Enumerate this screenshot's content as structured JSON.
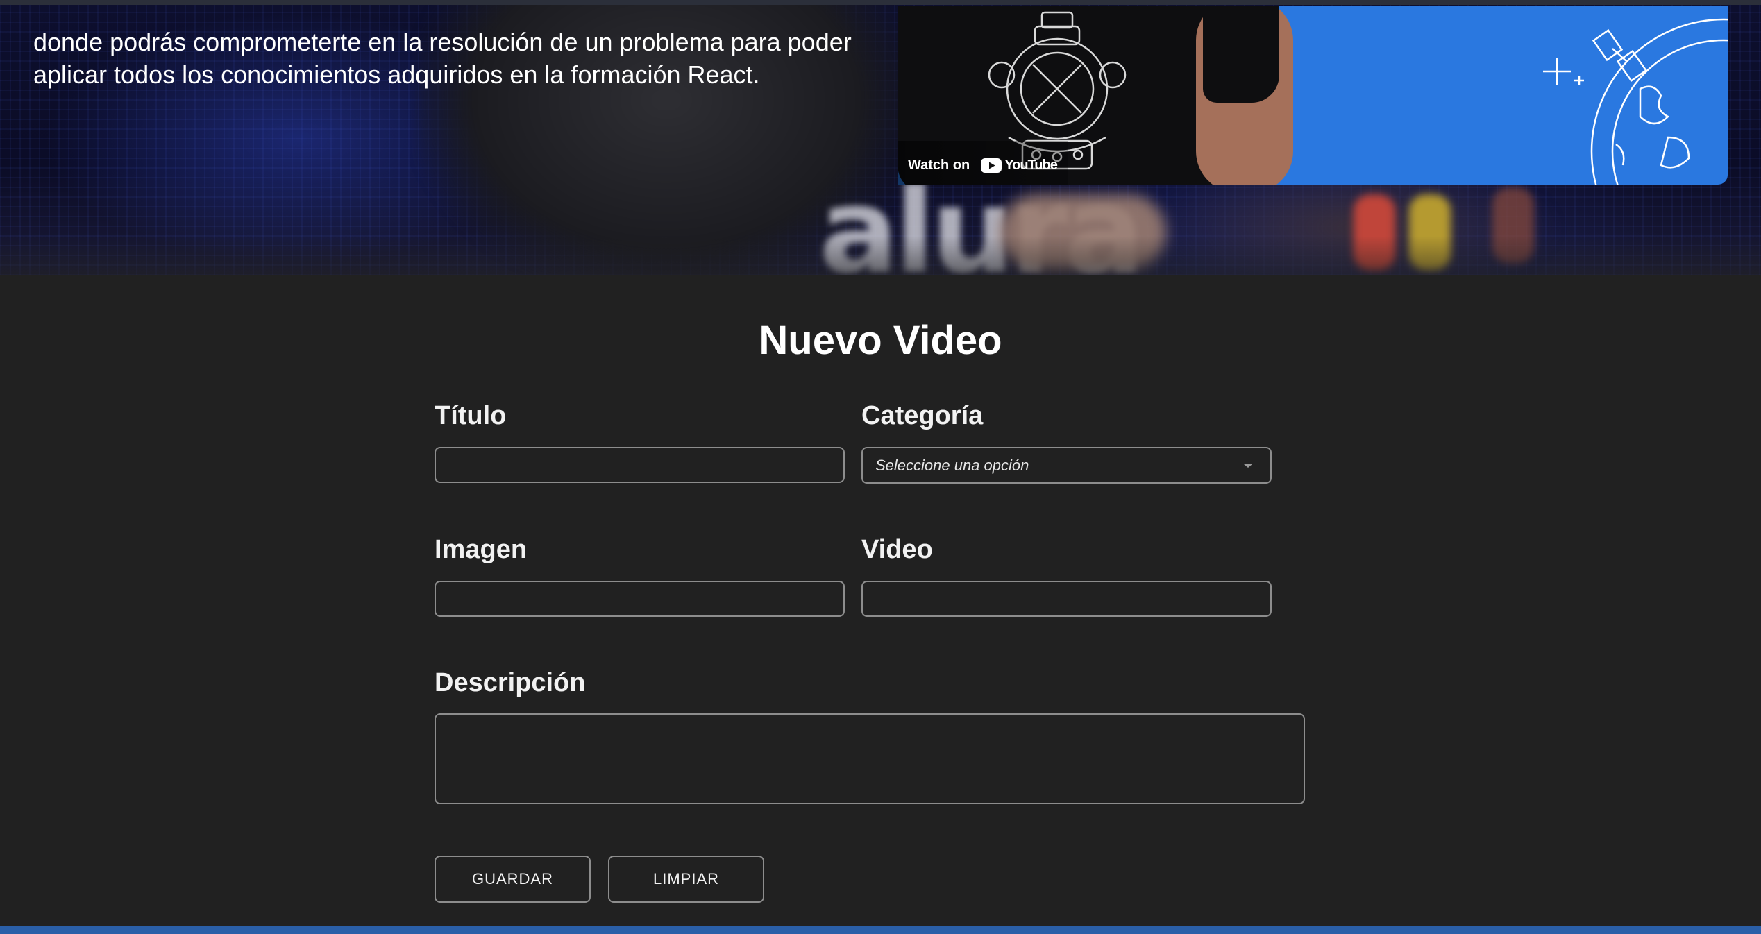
{
  "hero": {
    "description": "donde podrás comprometerte en la resolución de un problema para poder aplicar todos los conocimientos adquiridos en la formación React.",
    "brand_text": "alura",
    "video": {
      "watch_on_label": "Watch on",
      "youtube_label": "YouTube"
    }
  },
  "form": {
    "title": "Nuevo Video",
    "fields": {
      "titulo": {
        "label": "Título",
        "value": ""
      },
      "categoria": {
        "label": "Categoría",
        "selected": "Seleccione una opción"
      },
      "imagen": {
        "label": "Imagen",
        "value": ""
      },
      "video": {
        "label": "Video",
        "value": ""
      },
      "descripcion": {
        "label": "Descripción",
        "value": ""
      }
    },
    "buttons": {
      "save": "GUARDAR",
      "clear": "LIMPIAR"
    }
  },
  "colors": {
    "background": "#212121",
    "border": "#8d8d8d",
    "embed_blue": "#2a78e0",
    "bottom_accent": "#2a5fa8"
  }
}
